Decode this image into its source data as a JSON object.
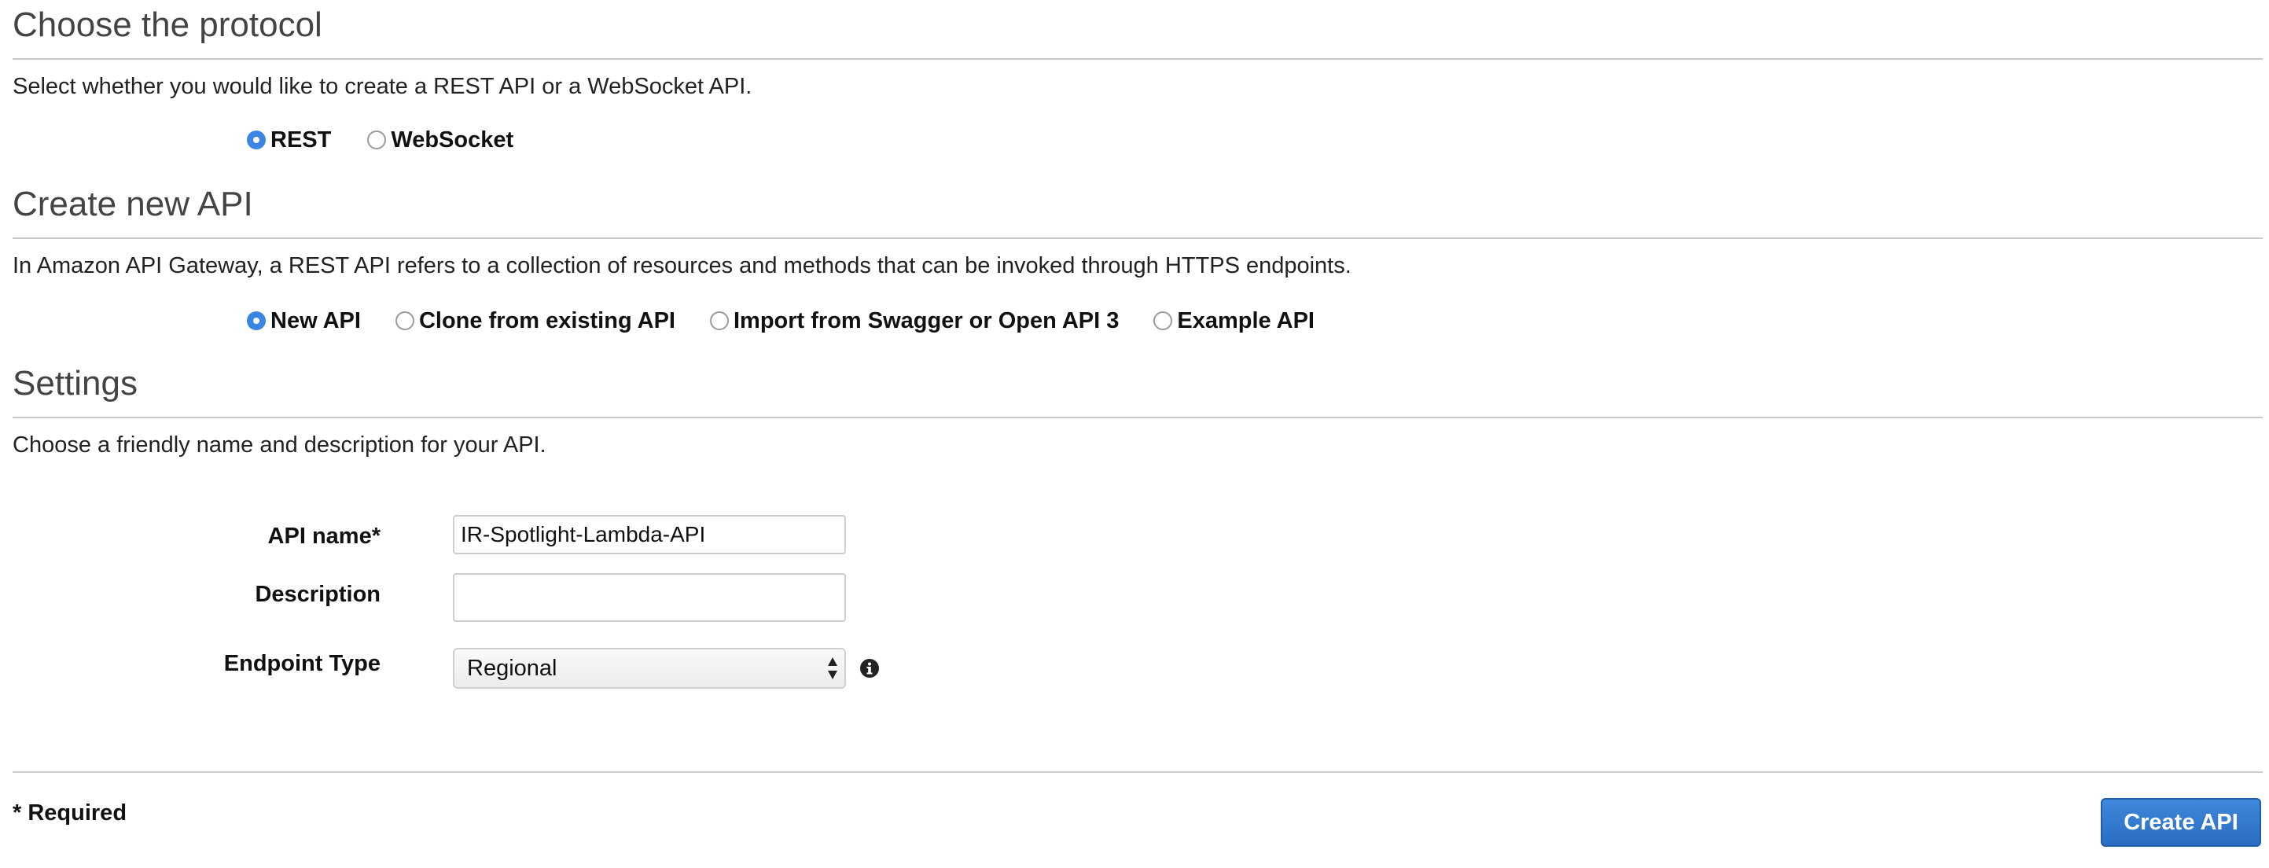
{
  "protocol": {
    "title": "Choose the protocol",
    "description": "Select whether you would like to create a REST API or a WebSocket API.",
    "options": [
      {
        "label": "REST",
        "checked": true
      },
      {
        "label": "WebSocket",
        "checked": false
      }
    ]
  },
  "create_api": {
    "title": "Create new API",
    "description": "In Amazon API Gateway, a REST API refers to a collection of resources and methods that can be invoked through HTTPS endpoints.",
    "options": [
      {
        "label": "New API",
        "checked": true
      },
      {
        "label": "Clone from existing API",
        "checked": false
      },
      {
        "label": "Import from Swagger or Open API 3",
        "checked": false
      },
      {
        "label": "Example API",
        "checked": false
      }
    ]
  },
  "settings": {
    "title": "Settings",
    "description": "Choose a friendly name and description for your API.",
    "api_name": {
      "label": "API name*",
      "value": "IR-Spotlight-Lambda-API"
    },
    "description_field": {
      "label": "Description",
      "value": ""
    },
    "endpoint_type": {
      "label": "Endpoint Type",
      "selected": "Regional"
    }
  },
  "footer": {
    "required_note": "* Required",
    "create_button": "Create API"
  },
  "colors": {
    "radio_selected": "#3b86e3",
    "primary_button": "#2a6dc3"
  }
}
